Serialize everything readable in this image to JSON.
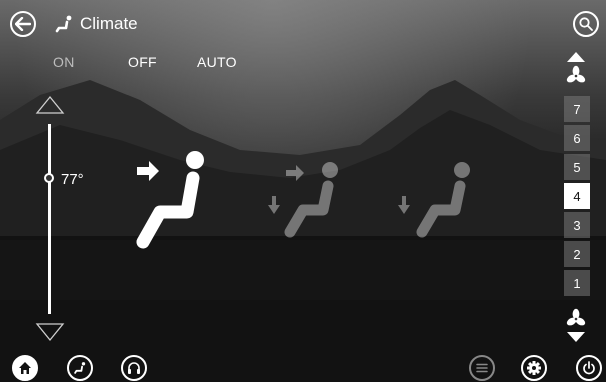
{
  "header": {
    "title": "Climate",
    "back_icon": "back-arrow-icon",
    "title_icon": "climate-seat-icon",
    "search_icon": "search-icon"
  },
  "modes": {
    "on_label": "ON",
    "off_label": "OFF",
    "auto_label": "AUTO"
  },
  "temperature": {
    "value": "77°",
    "up_icon": "triangle-up-icon",
    "down_icon": "triangle-down-icon"
  },
  "seats": [
    {
      "name": "driver-seat",
      "airflow": "face",
      "active": true
    },
    {
      "name": "passenger-seat",
      "airflow": "face-and-feet",
      "active": false
    },
    {
      "name": "rear-seat",
      "airflow": "feet",
      "active": false
    }
  ],
  "fan": {
    "levels": [
      "7",
      "6",
      "5",
      "4",
      "3",
      "2",
      "1"
    ],
    "selected": "4",
    "up_icon": "fan-up-icon",
    "down_icon": "fan-down-icon"
  },
  "bottom_nav": {
    "home": "home-icon",
    "climate": "climate-icon",
    "audio": "headphones-icon",
    "menu": "menu-icon",
    "settings": "gear-icon",
    "power": "power-icon"
  },
  "colors": {
    "text": "#ffffff",
    "inactive_mode": "#bdbdbd",
    "fan_active_bg": "#ffffff",
    "fan_inactive_bg": "#787878"
  }
}
